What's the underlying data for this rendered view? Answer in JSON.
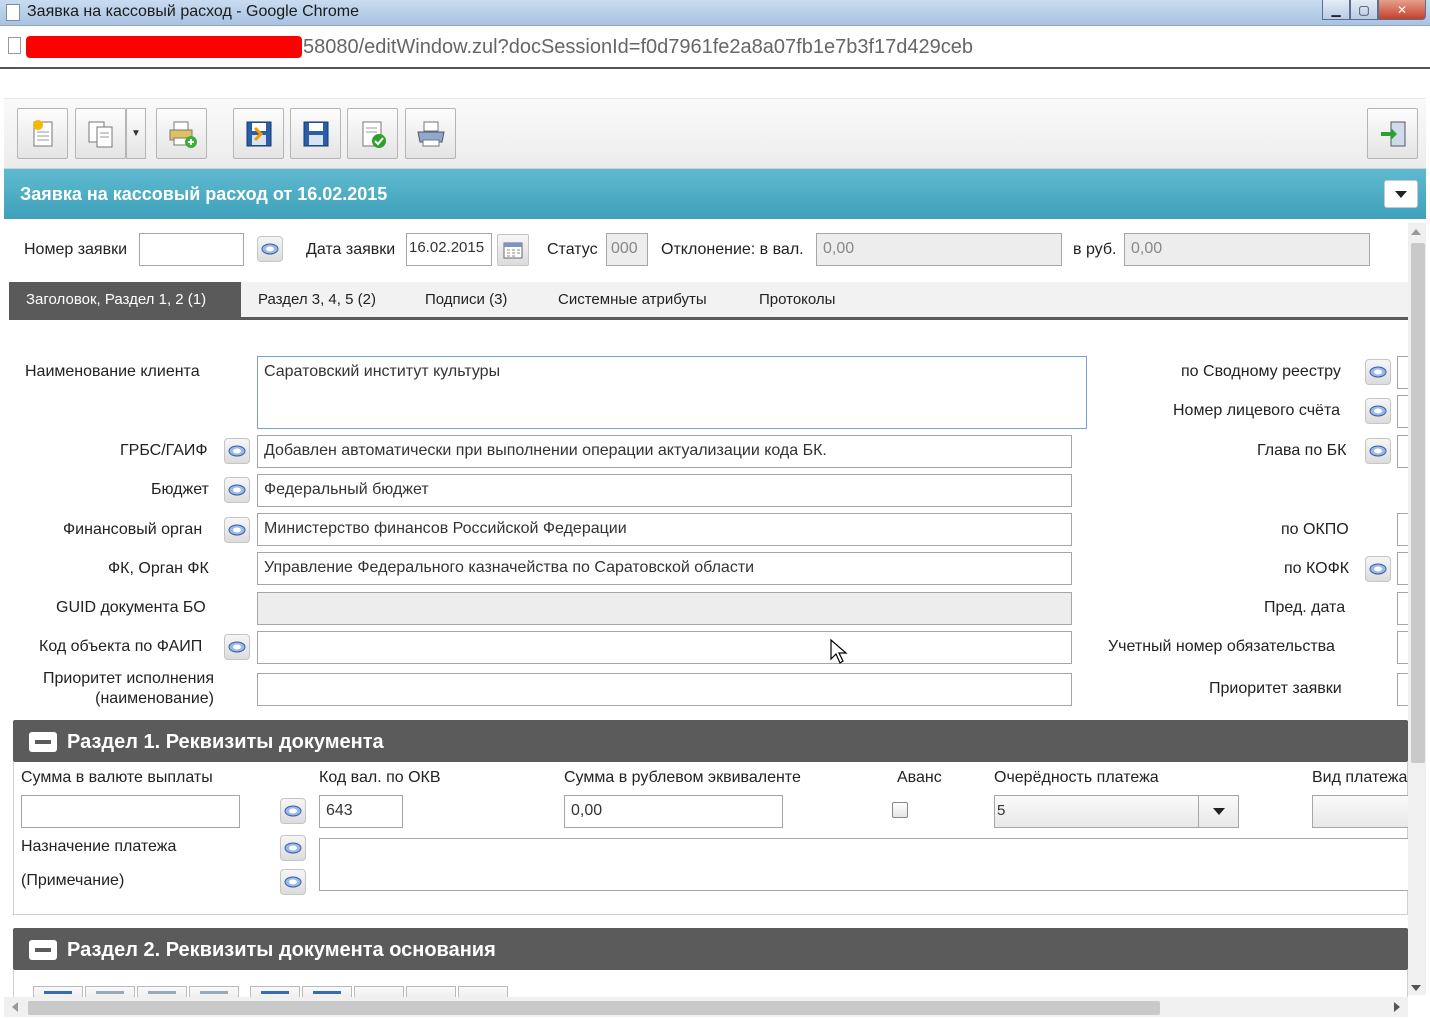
{
  "window": {
    "title": "Заявка на кассовый расход - Google Chrome",
    "url_visible": "58080/editWindow.zul?docSessionId=f0d7961fe2a8a07fb1e7b3f17d429ceb"
  },
  "toolbar": {
    "buttons": [
      "new-doc",
      "copy-doc",
      "print-add",
      "save-close",
      "save",
      "validate",
      "print"
    ],
    "exit": "exit"
  },
  "header": {
    "title": "Заявка на кассовый расход от 16.02.2015"
  },
  "top_fields": {
    "number_label": "Номер заявки",
    "number_value": "",
    "date_label": "Дата заявки",
    "date_value": "16.02.2015",
    "status_label": "Статус",
    "status_value": "000",
    "deviation_label": "Отклонение: в вал.",
    "deviation_value": "0,00",
    "rub_label": "в руб.",
    "rub_value": "0,00"
  },
  "tabs": [
    {
      "label": "Заголовок, Раздел 1, 2 (1)",
      "active": true
    },
    {
      "label": "Раздел 3, 4, 5 (2)",
      "active": false
    },
    {
      "label": "Подписи (3)",
      "active": false
    },
    {
      "label": "Системные атрибуты",
      "active": false
    },
    {
      "label": "Протоколы",
      "active": false
    }
  ],
  "form": {
    "client_name_label": "Наименование клиента",
    "client_name_value": "Саратовский институт культуры",
    "grbs_label": "ГРБС/ГАИФ",
    "grbs_value": "Добавлен автоматически при выполнении операции актуализации кода БК.",
    "budget_label": "Бюджет",
    "budget_value": "Федеральный бюджет",
    "fin_label": "Финансовый орган",
    "fin_value": "Министерство финансов Российской Федерации",
    "fk_label": "ФК, Орган ФК",
    "fk_value": "Управление Федерального казначейства по Саратовской области",
    "guid_label": "GUID документа БО",
    "guid_value": "",
    "faip_label": "Код объекта по ФАИП",
    "faip_value": "",
    "priority_label_1": "Приоритет исполнения",
    "priority_label_2": "(наименование)",
    "priority_value": ""
  },
  "right_labels": {
    "svod": "по Сводному реестру",
    "account": "Номер лицевого счёта",
    "glava": "Глава по БК",
    "okpo": "по ОКПО",
    "kofk": "по КОФК",
    "pred_date": "Пред. дата",
    "obligation": "Учетный номер обязательства",
    "priority": "Приоритет заявки"
  },
  "section1": {
    "title": "Раздел 1. Реквизиты документа",
    "sum_label": "Сумма в валюте выплаты",
    "sum_value": "",
    "currency_label": "Код вал. по ОКВ",
    "currency_value": "643",
    "rub_sum_label": "Сумма в рублевом эквиваленте",
    "rub_sum_value": "0,00",
    "advance_label": "Аванс",
    "queue_label": "Очерёдность платежа",
    "queue_value": "5",
    "pay_type_label": "Вид платежа",
    "purpose_label": "Назначение платежа",
    "note_label": "(Примечание)",
    "purpose_value": ""
  },
  "section2": {
    "title": "Раздел 2. Реквизиты документа основания"
  },
  "colors": {
    "header_bg": "#4aaac2",
    "section_bg": "#5b5b5b",
    "active_tab": "#5a5a5a"
  }
}
